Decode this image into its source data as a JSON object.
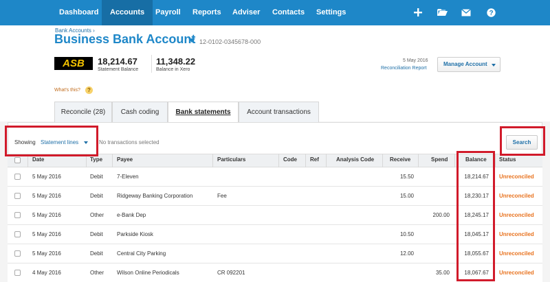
{
  "nav": {
    "items": [
      "Dashboard",
      "Accounts",
      "Payroll",
      "Reports",
      "Adviser",
      "Contacts",
      "Settings"
    ],
    "active": "Accounts"
  },
  "header": {
    "breadcrumb": "Bank Accounts ›",
    "title": "Business Bank Account",
    "account_number": "12-0102-0345678-000",
    "bank_logo": "ASB",
    "statement_balance": "18,214.67",
    "statement_balance_label": "Statement Balance",
    "xero_balance": "11,348.22",
    "xero_balance_label": "Balance in Xero",
    "recon_date": "5 May 2016",
    "recon_link": "Reconciliation Report",
    "manage_label": "Manage Account",
    "whats_this": "What's this?"
  },
  "tabs": [
    {
      "label": "Reconcile (28)"
    },
    {
      "label": "Cash coding"
    },
    {
      "label": "Bank statements"
    },
    {
      "label": "Account transactions"
    }
  ],
  "toolbar": {
    "showing": "Showing",
    "filter": "Statement lines",
    "selection": "No transactions selected",
    "search_label": "Search"
  },
  "table": {
    "columns": [
      "Date",
      "Type",
      "Payee",
      "Particulars",
      "Code",
      "Ref",
      "Analysis Code",
      "Receive",
      "Spend",
      "Balance",
      "Status"
    ],
    "rows": [
      {
        "date": "5 May 2016",
        "type": "Debit",
        "payee": "7-Eleven",
        "particulars": "",
        "receive": "15.50",
        "spend": "",
        "balance": "18,214.67",
        "status": "Unreconciled"
      },
      {
        "date": "5 May 2016",
        "type": "Debit",
        "payee": "Ridgeway Banking Corporation",
        "particulars": "Fee",
        "receive": "15.00",
        "spend": "",
        "balance": "18,230.17",
        "status": "Unreconciled"
      },
      {
        "date": "5 May 2016",
        "type": "Other",
        "payee": "e-Bank Dep",
        "particulars": "",
        "receive": "",
        "spend": "200.00",
        "balance": "18,245.17",
        "status": "Unreconciled"
      },
      {
        "date": "5 May 2016",
        "type": "Debit",
        "payee": "Parkside Kiosk",
        "particulars": "",
        "receive": "10.50",
        "spend": "",
        "balance": "18,045.17",
        "status": "Unreconciled"
      },
      {
        "date": "5 May 2016",
        "type": "Debit",
        "payee": "Central City Parking",
        "particulars": "",
        "receive": "12.00",
        "spend": "",
        "balance": "18,055.67",
        "status": "Unreconciled"
      },
      {
        "date": "4 May 2016",
        "type": "Other",
        "payee": "Wilson Online Periodicals",
        "particulars": "CR 092201",
        "receive": "",
        "spend": "35.00",
        "balance": "18,067.67",
        "status": "Unreconciled"
      }
    ]
  },
  "colors": {
    "nav_bg": "#1e87c8",
    "accent": "#1e6fa7",
    "status": "#e8711c",
    "highlight": "#d11a2a"
  },
  "icons": [
    "plus-icon",
    "folder-icon",
    "mail-icon",
    "help-icon"
  ]
}
